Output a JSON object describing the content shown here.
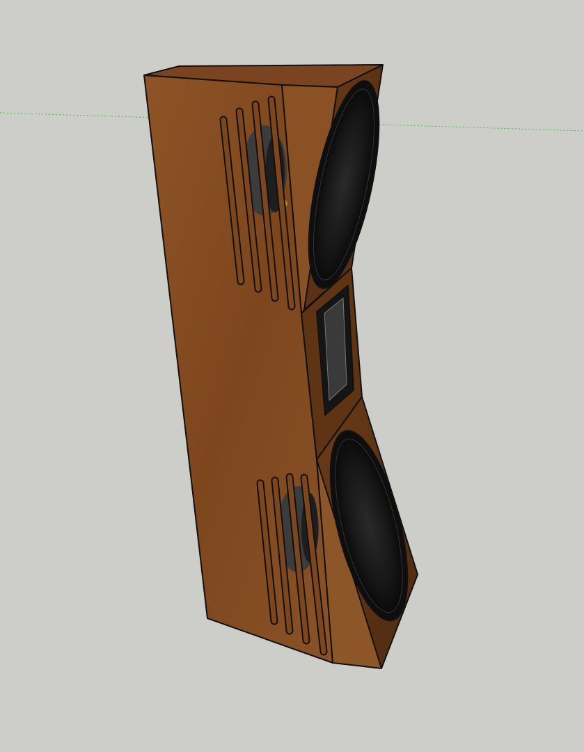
{
  "scene": {
    "background": "#cdcdc9",
    "axis_color": "#3fbf3f",
    "wood_light": "#8a4f22",
    "wood_dark": "#5a3214",
    "driver_color": "#1a1a1a",
    "outline": "#111111"
  }
}
